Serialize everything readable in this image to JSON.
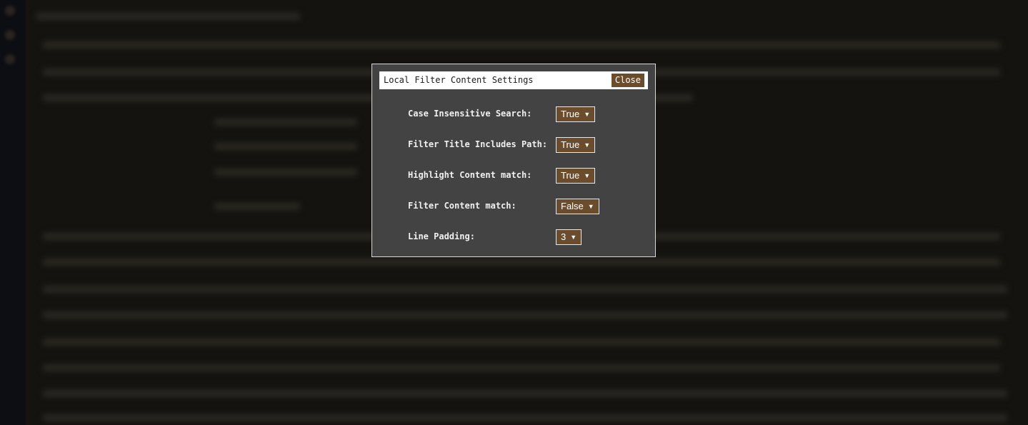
{
  "dialog": {
    "title": "Local Filter Content Settings",
    "close_label": "Close"
  },
  "settings": [
    {
      "label": "Case Insensitive Search:",
      "value": "True"
    },
    {
      "label": "Filter Title Includes Path:",
      "value": "True"
    },
    {
      "label": "Highlight Content match:",
      "value": "True"
    },
    {
      "label": "Filter Content match:",
      "value": "False"
    },
    {
      "label": "Line Padding:",
      "value": "3"
    }
  ],
  "icons": {
    "dropdown": "chevron-down-icon"
  },
  "colors": {
    "accent": "#6b4d2e",
    "modal_bg": "#434343",
    "backdrop": "#15130f"
  }
}
